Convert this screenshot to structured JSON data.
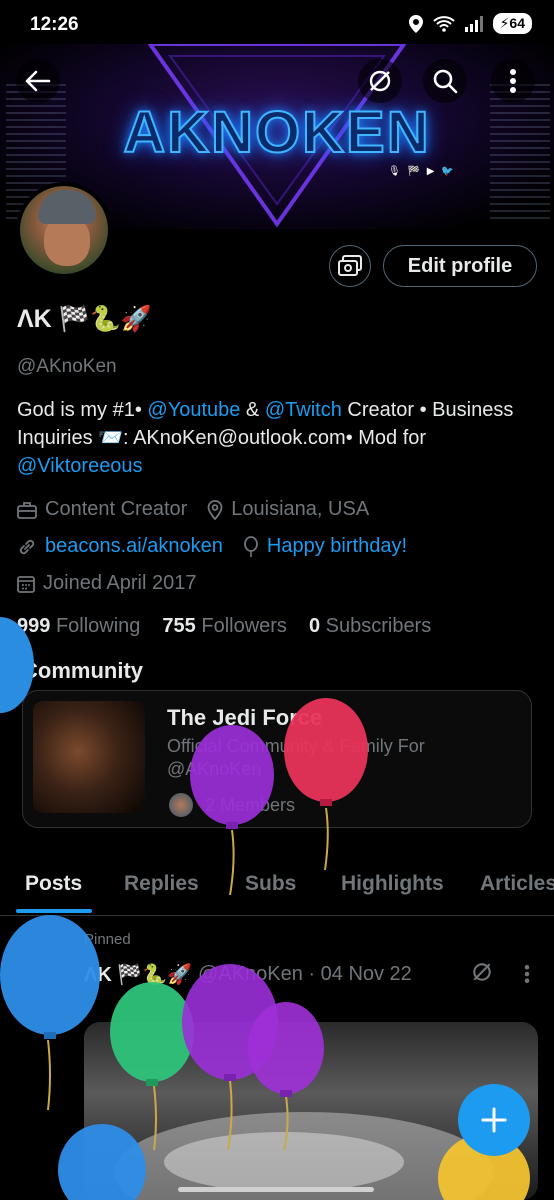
{
  "status_bar": {
    "time": "12:26",
    "battery": "64"
  },
  "banner": {
    "logo_text": "AKNOKEN",
    "social_strip": "🎙 🏁 ▶ 🐦"
  },
  "profile": {
    "display_name": "ΛK 🏁🐍🚀",
    "handle": "@AKnoKen",
    "edit_profile_label": "Edit profile",
    "bio": {
      "part1": "God is my #1• ",
      "link1": "@Youtube",
      "part2": " & ",
      "link2": "@Twitch",
      "part3": " Creator • Business Inquiries 📨: AKnoKen@outlook.com• Mod for ",
      "link3": "@Viktoreeous"
    },
    "category": "Content Creator",
    "location": "Louisiana, USA",
    "website": "beacons.ai/aknoken",
    "birthday": "Happy birthday!",
    "joined": "Joined April 2017",
    "counts": {
      "following_num": "999",
      "following_label": "Following",
      "followers_num": "755",
      "followers_label": "Followers",
      "subscribers_num": "0",
      "subscribers_label": "Subscribers"
    }
  },
  "community": {
    "section_title": "Community",
    "name": "The Jedi Force",
    "description": "Official Community & Family For @AKnoKen",
    "members": "2 Members"
  },
  "tabs": [
    "Posts",
    "Replies",
    "Subs",
    "Highlights",
    "Articles"
  ],
  "pinned_post": {
    "pinned_label": "Pinned",
    "author": "ΛK 🏁🐍🚀",
    "handle_date": "@AKnoKen · 04 Nov 22"
  },
  "colors": {
    "accent": "#1d9bf0",
    "muted": "#71767b",
    "text": "#e7e9ea"
  }
}
